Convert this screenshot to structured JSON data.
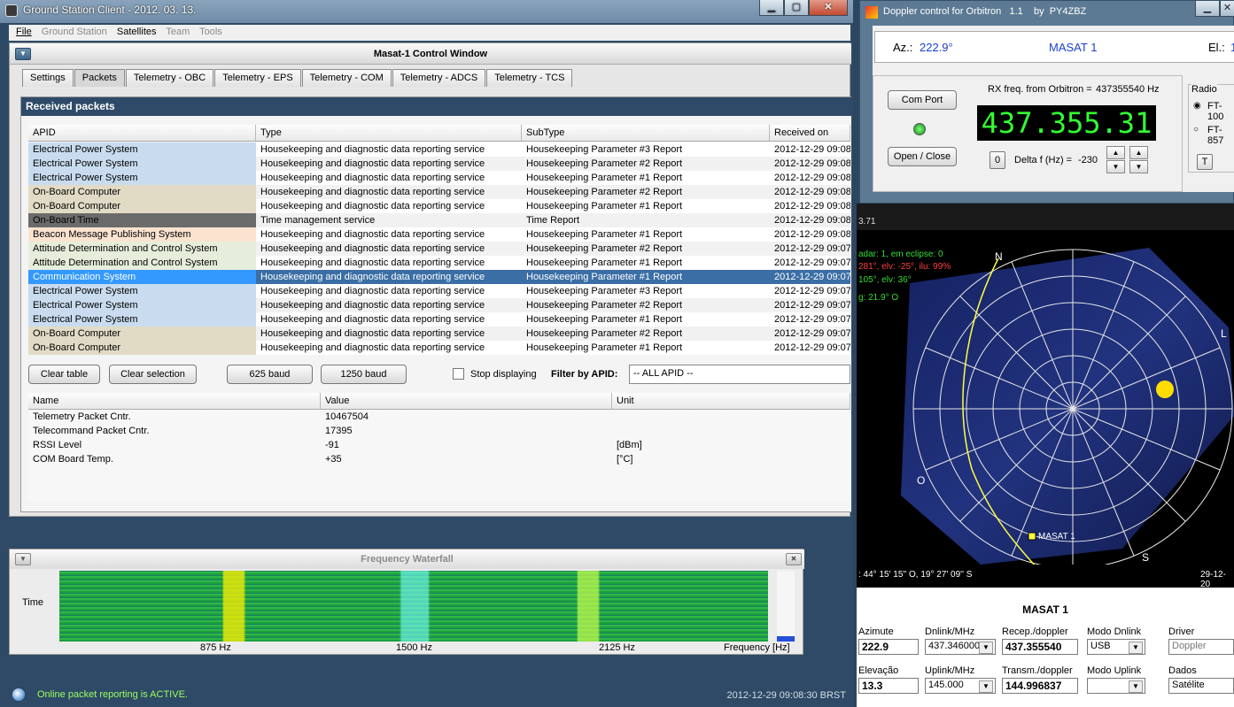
{
  "main_window": {
    "title": "Ground Station Client - 2012. 03. 13."
  },
  "menu": [
    {
      "label": "File",
      "enabled": true
    },
    {
      "label": "Ground Station",
      "enabled": false
    },
    {
      "label": "Satellites",
      "enabled": true
    },
    {
      "label": "Team",
      "enabled": false
    },
    {
      "label": "Tools",
      "enabled": false
    }
  ],
  "control_window": {
    "title": "Masat-1 Control Window"
  },
  "tabs": [
    "Settings",
    "Packets",
    "Telemetry - OBC",
    "Telemetry - EPS",
    "Telemetry - COM",
    "Telemetry - ADCS",
    "Telemetry - TCS"
  ],
  "active_tab": "Packets",
  "received": {
    "title": "Received packets",
    "columns": [
      "APID",
      "Type",
      "SubType",
      "Received on"
    ],
    "rows": [
      {
        "apid": "Electrical Power System",
        "type": "Housekeeping and diagnostic data reporting service",
        "subtype": "Housekeeping Parameter #3 Report",
        "time": "2012-12-29 09:08"
      },
      {
        "apid": "Electrical Power System",
        "type": "Housekeeping and diagnostic data reporting service",
        "subtype": "Housekeeping Parameter #2 Report",
        "time": "2012-12-29 09:08"
      },
      {
        "apid": "Electrical Power System",
        "type": "Housekeeping and diagnostic data reporting service",
        "subtype": "Housekeeping Parameter #1 Report",
        "time": "2012-12-29 09:08"
      },
      {
        "apid": "On-Board Computer",
        "type": "Housekeeping and diagnostic data reporting service",
        "subtype": "Housekeeping Parameter #2 Report",
        "time": "2012-12-29 09:08"
      },
      {
        "apid": "On-Board Computer",
        "type": "Housekeeping and diagnostic data reporting service",
        "subtype": "Housekeeping Parameter #1 Report",
        "time": "2012-12-29 09:08"
      },
      {
        "apid": "On-Board Time",
        "type": "Time management service",
        "subtype": "Time Report",
        "time": "2012-12-29 09:08"
      },
      {
        "apid": "Beacon Message Publishing System",
        "type": "Housekeeping and diagnostic data reporting service",
        "subtype": "Housekeeping Parameter #1 Report",
        "time": "2012-12-29 09:08"
      },
      {
        "apid": "Attitude Determination and Control System",
        "type": "Housekeeping and diagnostic data reporting service",
        "subtype": "Housekeeping Parameter #2 Report",
        "time": "2012-12-29 09:07"
      },
      {
        "apid": "Attitude Determination and Control System",
        "type": "Housekeeping and diagnostic data reporting service",
        "subtype": "Housekeeping Parameter #1 Report",
        "time": "2012-12-29 09:07"
      },
      {
        "apid": "Communication System",
        "type": "Housekeeping and diagnostic data reporting service",
        "subtype": "Housekeeping Parameter #1 Report",
        "time": "2012-12-29 09:07"
      },
      {
        "apid": "Electrical Power System",
        "type": "Housekeeping and diagnostic data reporting service",
        "subtype": "Housekeeping Parameter #3 Report",
        "time": "2012-12-29 09:07"
      },
      {
        "apid": "Electrical Power System",
        "type": "Housekeeping and diagnostic data reporting service",
        "subtype": "Housekeeping Parameter #2 Report",
        "time": "2012-12-29 09:07"
      },
      {
        "apid": "Electrical Power System",
        "type": "Housekeeping and diagnostic data reporting service",
        "subtype": "Housekeeping Parameter #1 Report",
        "time": "2012-12-29 09:07"
      },
      {
        "apid": "On-Board Computer",
        "type": "Housekeeping and diagnostic data reporting service",
        "subtype": "Housekeeping Parameter #2 Report",
        "time": "2012-12-29 09:07"
      },
      {
        "apid": "On-Board Computer",
        "type": "Housekeeping and diagnostic data reporting service",
        "subtype": "Housekeeping Parameter #1 Report",
        "time": "2012-12-29 09:07"
      }
    ],
    "selected_index": 9,
    "apid_colors": {
      "Electrical Power System": "#c9dcef",
      "On-Board Computer": "#e1dbc6",
      "On-Board Time": "#6b6b6b",
      "Beacon Message Publishing System": "#fbe3d0",
      "Attitude Determination and Control System": "#e6eedb",
      "Communication System": "#3399ff"
    }
  },
  "buttons": {
    "clear_table": "Clear table",
    "clear_selection": "Clear selection",
    "baud_625": "625 baud",
    "baud_1250": "1250 baud"
  },
  "stop_displaying": "Stop displaying",
  "filter": {
    "label": "Filter by APID:",
    "value": "-- ALL APID --"
  },
  "telemetry": {
    "columns": [
      "Name",
      "Value",
      "Unit"
    ],
    "rows": [
      {
        "name": "Telemetry Packet Cntr.",
        "value": "10467504",
        "unit": ""
      },
      {
        "name": "Telecommand Packet Cntr.",
        "value": "17395",
        "unit": ""
      },
      {
        "name": "RSSI Level",
        "value": "-91",
        "unit": "[dBm]"
      },
      {
        "name": "COM Board Temp.",
        "value": "+35",
        "unit": "[°C]"
      }
    ]
  },
  "waterfall": {
    "title": "Frequency Waterfall",
    "y_label": "Time",
    "ticks": [
      "875 Hz",
      "1500 Hz",
      "2125 Hz"
    ],
    "x_label": "Frequency [Hz]"
  },
  "status": {
    "message": "Online packet reporting is ACTIVE.",
    "time": "2012-12-29 09:08:30 BRST"
  },
  "doppler": {
    "title": "Doppler control for Orbitron   1.1    by  PY4ZBZ",
    "az_label": "Az.:",
    "az": "222.9°",
    "sat": "MASAT 1",
    "el_label": "El.:",
    "el": "1",
    "com_port": "Com Port",
    "open_close": "Open / Close",
    "rx_label": "RX freq. from Orbitron =",
    "rx_value": "437355540 Hz",
    "freq": "437.355.31",
    "zero": "0",
    "delta_label": "Delta f (Hz) =",
    "delta": "-230",
    "radio_label": "Radio",
    "radio_1": "FT-100",
    "radio_2": "FT-857",
    "t_button": "T"
  },
  "orbitron": {
    "partial_header": "3.71",
    "info1": "adar: 1, em eclipse: 0",
    "info2": "281°, elv: -25°, ilu: 99%",
    "info3": "105°, elv: 36°",
    "info4": "g: 21.9° O",
    "n": "N",
    "l": "L",
    "o": "O",
    "s": "S",
    "sat_label": "MASAT 1",
    "coords": ": 44° 15' 15'' O, 19° 27' 09'' S",
    "date": "29-12-20",
    "colors": {
      "info2": "#ff4040",
      "info3": "#33dd33",
      "info4": "#33dd33",
      "info1": "#33dd33"
    }
  },
  "orbpanel": {
    "title": "MASAT 1",
    "azimute_label": "Azimute",
    "azimute": "222.9",
    "dnlink_label": "Dnlink/MHz",
    "dnlink": "437.346000",
    "recep_label": "Recep./doppler",
    "recep": "437.355540",
    "modo_dn_label": "Modo Dnlink",
    "modo_dn": "USB",
    "driver_label": "Driver",
    "driver": "Doppler",
    "elev_label": "Elevação",
    "elev": "13.3",
    "uplink_label": "Uplink/MHz",
    "uplink": "145.000",
    "transm_label": "Transm./doppler",
    "transm": "144.996837",
    "modo_up_label": "Modo Uplink",
    "modo_up": "",
    "dados_label": "Dados",
    "dados": "Satélite"
  }
}
